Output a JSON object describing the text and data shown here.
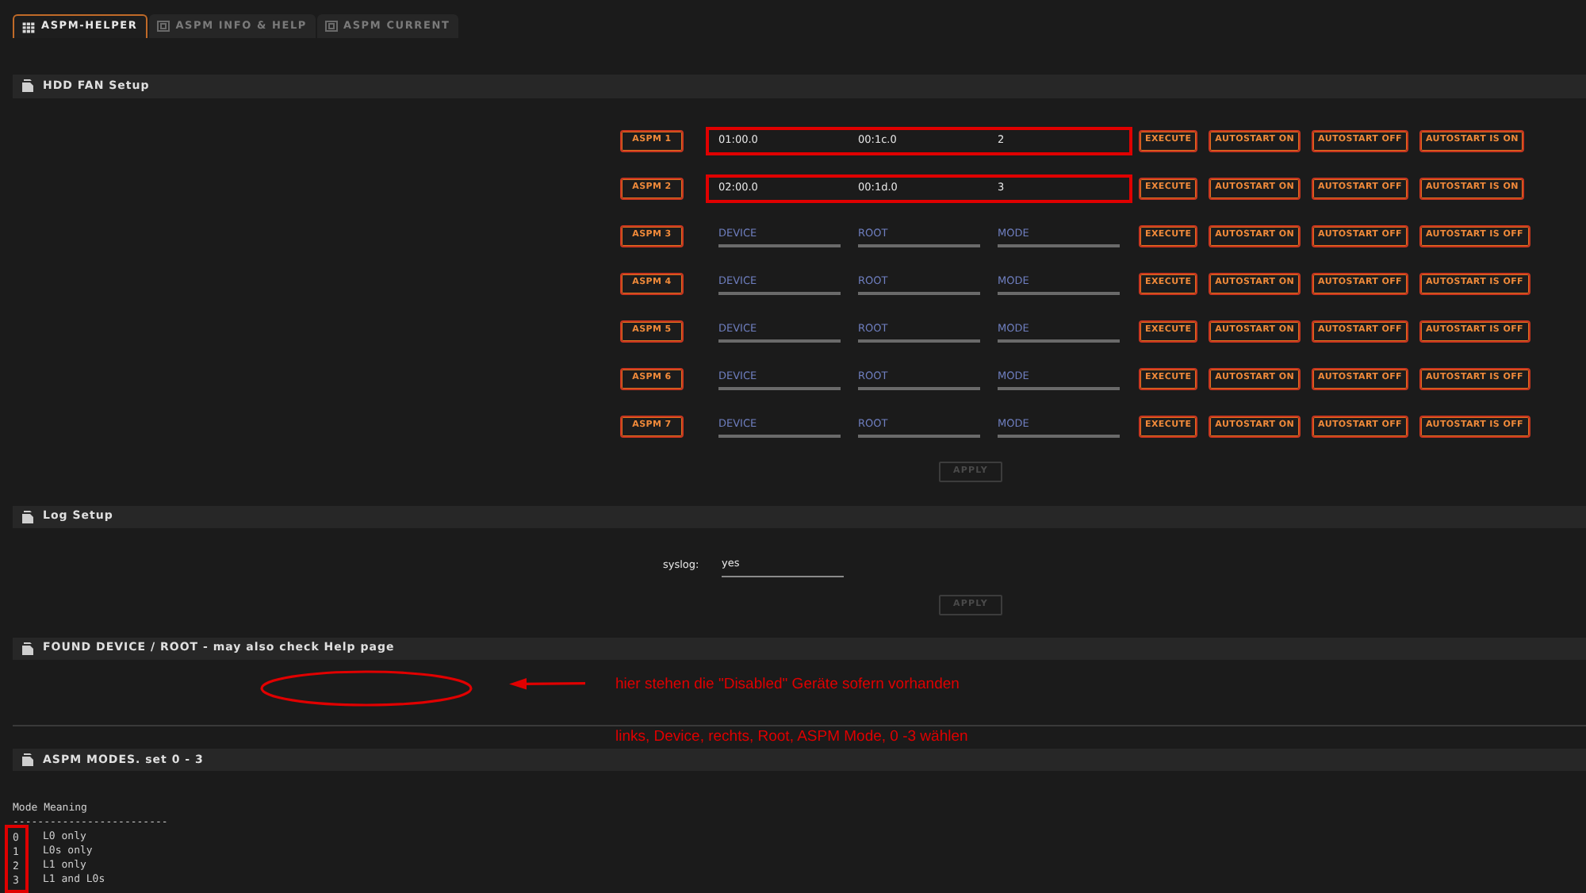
{
  "tabs": [
    {
      "label": "ASPM-HELPER",
      "selected": true
    },
    {
      "label": "ASPM INFO & HELP",
      "selected": false
    },
    {
      "label": "ASPM CURRENT",
      "selected": false
    }
  ],
  "hdd_fan_setup": {
    "title": "HDD FAN Setup",
    "rows": [
      {
        "label": "ASPM 1",
        "device": {
          "value": "01:00.0"
        },
        "root": {
          "value": "00:1c.0"
        },
        "mode": {
          "value": "2"
        },
        "highlighted": true,
        "buttons": [
          "EXECUTE",
          "AUTOSTART ON",
          "AUTOSTART OFF"
        ],
        "status": "AUTOSTART IS ON"
      },
      {
        "label": "ASPM 2",
        "device": {
          "value": "02:00.0"
        },
        "root": {
          "value": "00:1d.0"
        },
        "mode": {
          "value": "3"
        },
        "highlighted": true,
        "buttons": [
          "EXECUTE",
          "AUTOSTART ON",
          "AUTOSTART OFF"
        ],
        "status": "AUTOSTART IS ON"
      },
      {
        "label": "ASPM 3",
        "device": {
          "placeholder": "DEVICE"
        },
        "root": {
          "placeholder": "ROOT"
        },
        "mode": {
          "placeholder": "MODE"
        },
        "highlighted": false,
        "buttons": [
          "EXECUTE",
          "AUTOSTART ON",
          "AUTOSTART OFF"
        ],
        "status": "AUTOSTART IS OFF"
      },
      {
        "label": "ASPM 4",
        "device": {
          "placeholder": "DEVICE"
        },
        "root": {
          "placeholder": "ROOT"
        },
        "mode": {
          "placeholder": "MODE"
        },
        "highlighted": false,
        "buttons": [
          "EXECUTE",
          "AUTOSTART ON",
          "AUTOSTART OFF"
        ],
        "status": "AUTOSTART IS OFF"
      },
      {
        "label": "ASPM 5",
        "device": {
          "placeholder": "DEVICE"
        },
        "root": {
          "placeholder": "ROOT"
        },
        "mode": {
          "placeholder": "MODE"
        },
        "highlighted": false,
        "buttons": [
          "EXECUTE",
          "AUTOSTART ON",
          "AUTOSTART OFF"
        ],
        "status": "AUTOSTART IS OFF"
      },
      {
        "label": "ASPM 6",
        "device": {
          "placeholder": "DEVICE"
        },
        "root": {
          "placeholder": "ROOT"
        },
        "mode": {
          "placeholder": "MODE"
        },
        "highlighted": false,
        "buttons": [
          "EXECUTE",
          "AUTOSTART ON",
          "AUTOSTART OFF"
        ],
        "status": "AUTOSTART IS OFF"
      },
      {
        "label": "ASPM 7",
        "device": {
          "placeholder": "DEVICE"
        },
        "root": {
          "placeholder": "ROOT"
        },
        "mode": {
          "placeholder": "MODE"
        },
        "highlighted": false,
        "buttons": [
          "EXECUTE",
          "AUTOSTART ON",
          "AUTOSTART OFF"
        ],
        "status": "AUTOSTART IS OFF"
      }
    ],
    "apply": {
      "label": "APPLY",
      "disabled": true
    }
  },
  "log_setup": {
    "title": "Log Setup",
    "label": "syslog:",
    "value": "yes",
    "apply": {
      "label": "APPLY",
      "disabled": true
    }
  },
  "found_device": {
    "title": "FOUND DEVICE / ROOT - may also check Help page",
    "annotations": [
      "hier stehen die \"Disabled\" Geräte sofern vorhanden",
      "links, Device, rechts, Root, ASPM Mode, 0 -3 wählen"
    ]
  },
  "aspm_modes": {
    "title": "ASPM MODES. set 0 - 3",
    "header": "Mode Meaning",
    "separator": "-------------------------",
    "modes": [
      {
        "mode": "0",
        "meaning": "L0 only"
      },
      {
        "mode": "1",
        "meaning": "L0s only"
      },
      {
        "mode": "2",
        "meaning": "L1 only"
      },
      {
        "mode": "3",
        "meaning": "L1 and L0s"
      }
    ],
    "highlighted": true
  }
}
